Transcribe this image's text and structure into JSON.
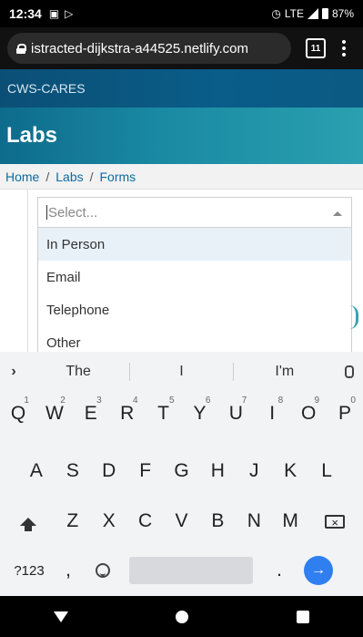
{
  "status_bar": {
    "time": "12:34",
    "network": "LTE",
    "battery": "87%",
    "icons": [
      "image-icon",
      "play-store-icon",
      "alarm-icon",
      "signal-icon",
      "battery-icon"
    ]
  },
  "browser": {
    "url": "istracted-dijkstra-a44525.netlify.com",
    "tab_count": "11",
    "icons": [
      "lock-icon",
      "tabs-icon",
      "menu-icon"
    ]
  },
  "site": {
    "brand": "CWS-CARES",
    "page_title": "Labs",
    "colors": {
      "header": "#0b4f76",
      "band": "#1a8aa3",
      "link": "#0f6aa0"
    }
  },
  "breadcrumb": {
    "items": [
      "Home",
      "Labs",
      "Forms"
    ],
    "separator": "/"
  },
  "select": {
    "placeholder": "Select...",
    "options": [
      "In Person",
      "Email",
      "Telephone",
      "Other"
    ]
  },
  "keyboard": {
    "suggestions": [
      "The",
      "I",
      "I'm"
    ],
    "row1": [
      "Q",
      "W",
      "E",
      "R",
      "T",
      "Y",
      "U",
      "I",
      "O",
      "P"
    ],
    "row1_hints": [
      "1",
      "2",
      "3",
      "4",
      "5",
      "6",
      "7",
      "8",
      "9",
      "0"
    ],
    "row2": [
      "A",
      "S",
      "D",
      "F",
      "G",
      "H",
      "J",
      "K",
      "L"
    ],
    "row3": [
      "Z",
      "X",
      "C",
      "V",
      "B",
      "N",
      "M"
    ],
    "symbols_label": "?123",
    "comma": ",",
    "period": ".",
    "icons": [
      "chevron-right-icon",
      "mic-icon",
      "shift-icon",
      "backspace-icon",
      "emoji-icon",
      "enter-icon"
    ]
  },
  "nav": {
    "icons": [
      "back-icon",
      "home-icon",
      "recents-icon"
    ]
  }
}
